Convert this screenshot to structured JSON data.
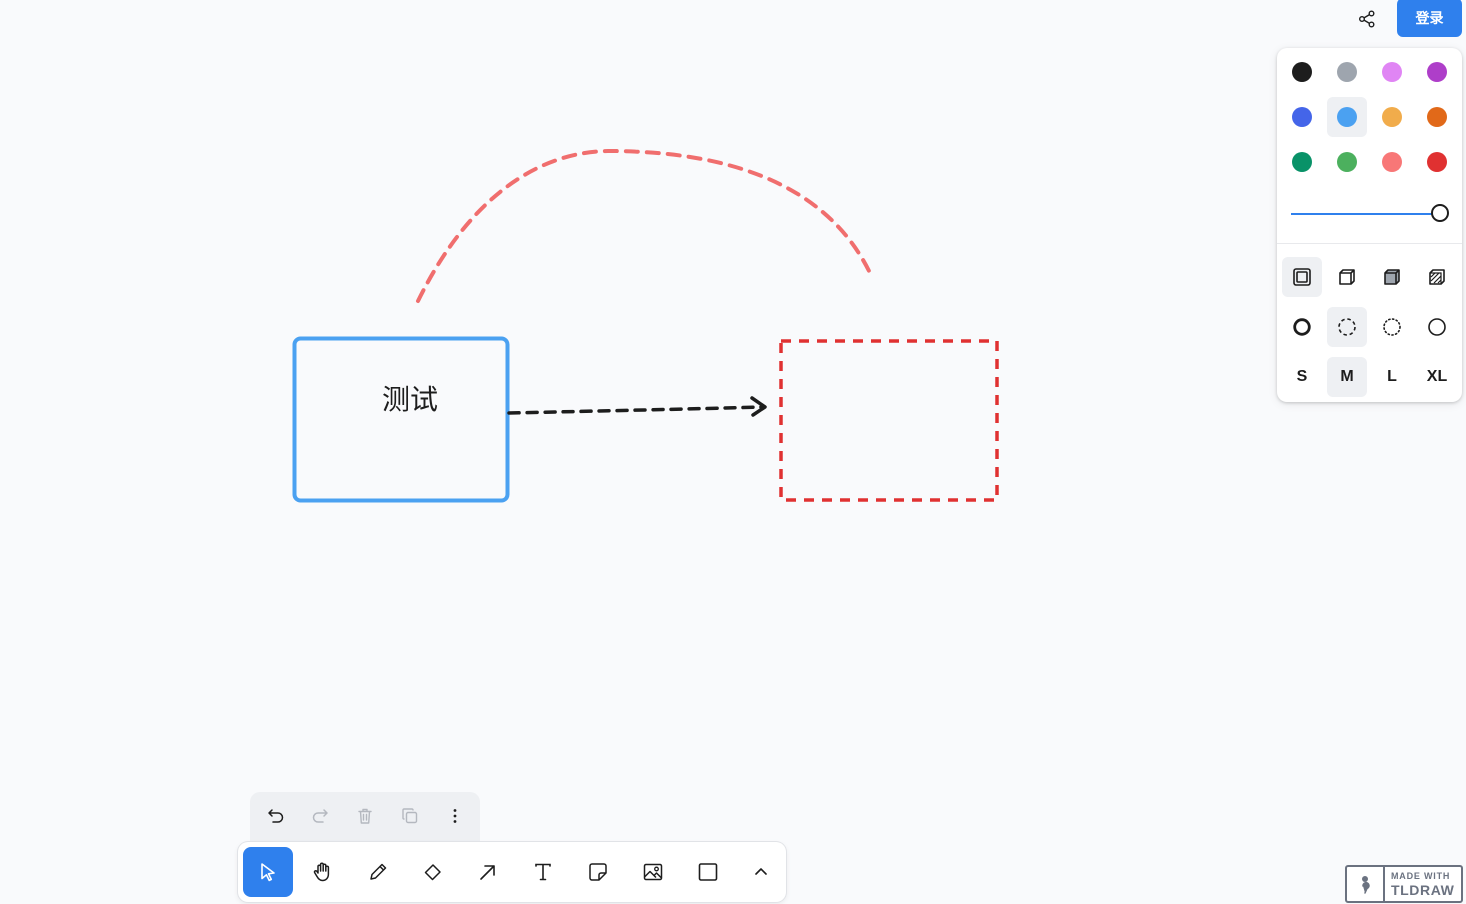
{
  "canvas": {
    "text_shape_label": "测试"
  },
  "top_right": {
    "share_icon": "share-icon",
    "login_label": "登录"
  },
  "style_panel": {
    "colors": [
      {
        "name": "black",
        "hex": "#1d1d1d"
      },
      {
        "name": "grey",
        "hex": "#9ea5ae"
      },
      {
        "name": "light-violet",
        "hex": "#e085f4"
      },
      {
        "name": "violet",
        "hex": "#ae3ec9"
      },
      {
        "name": "blue",
        "hex": "#4465e9"
      },
      {
        "name": "light-blue",
        "hex": "#4ba1f1",
        "selected": true
      },
      {
        "name": "yellow",
        "hex": "#f1ac4b"
      },
      {
        "name": "orange",
        "hex": "#e16919"
      },
      {
        "name": "green",
        "hex": "#099268"
      },
      {
        "name": "light-green",
        "hex": "#4cb05e"
      },
      {
        "name": "light-red",
        "hex": "#f87777"
      },
      {
        "name": "red",
        "hex": "#e03131"
      }
    ],
    "opacity_value": 1,
    "fill_options": [
      "fill-none-icon",
      "fill-semi-icon",
      "fill-solid-icon",
      "fill-pattern-icon"
    ],
    "dash_options": [
      "dash-draw-icon",
      "dash-dashed-icon",
      "dash-dotted-icon",
      "dash-solid-icon"
    ],
    "size_options": [
      "S",
      "M",
      "L",
      "XL"
    ],
    "selected_size": "M"
  },
  "action_bar": {
    "items": [
      "undo-icon",
      "redo-icon",
      "trash-icon",
      "duplicate-icon",
      "more-icon"
    ]
  },
  "toolbar": {
    "tools": [
      "select-icon",
      "hand-icon",
      "pencil-icon",
      "eraser-icon",
      "arrow-icon",
      "text-icon",
      "note-icon",
      "image-icon",
      "rectangle-icon",
      "chevron-up-icon"
    ],
    "selected": "select-icon"
  },
  "watermark": {
    "line1": "MADE WITH",
    "line2": "TLDRAW"
  }
}
